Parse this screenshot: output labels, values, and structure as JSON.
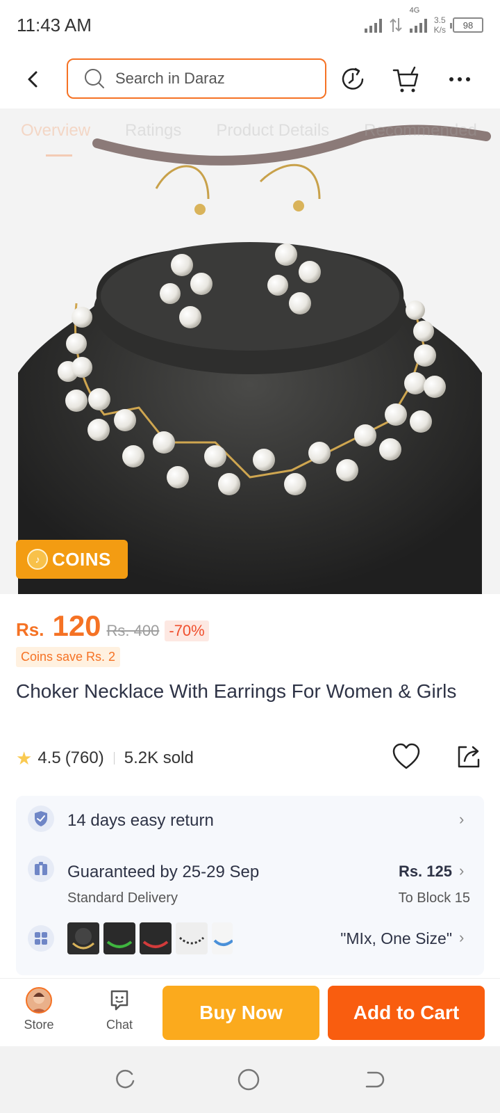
{
  "status_bar": {
    "time": "11:43 AM",
    "network": "4G",
    "speed_value": "3.5",
    "speed_unit": "K/s",
    "battery": "98"
  },
  "header": {
    "search_placeholder": "Search in Daraz",
    "icons": [
      "back-arrow-icon",
      "search-icon",
      "history-icon",
      "cart-icon",
      "more-icon"
    ]
  },
  "product_image": {
    "tabs": [
      "Overview",
      "Ratings",
      "Product Details",
      "Recommended"
    ],
    "coins_badge": "COINS"
  },
  "price": {
    "currency": "Rs.",
    "current": "120",
    "original": "Rs. 400",
    "discount": "-70%",
    "coins_save": "Coins save Rs. 2"
  },
  "product": {
    "title": "Choker Necklace With Earrings For Women & Girls",
    "rating": "4.5",
    "rating_count": "(760)",
    "sold": "5.2K sold"
  },
  "info": {
    "return_policy": "14 days easy return",
    "delivery_title": "Guaranteed by 25-29 Sep",
    "delivery_type": "Standard Delivery",
    "delivery_price": "Rs. 125",
    "delivery_location": "To Block 15",
    "variant": "\"MIx, One Size\""
  },
  "bottom_bar": {
    "store_label": "Store",
    "chat_label": "Chat",
    "buy_now": "Buy Now",
    "add_to_cart": "Add to Cart"
  },
  "colors": {
    "brand_orange": "#f57224",
    "buy_now_bg": "#fbaa1d",
    "add_to_cart_bg": "#f95d0f"
  }
}
